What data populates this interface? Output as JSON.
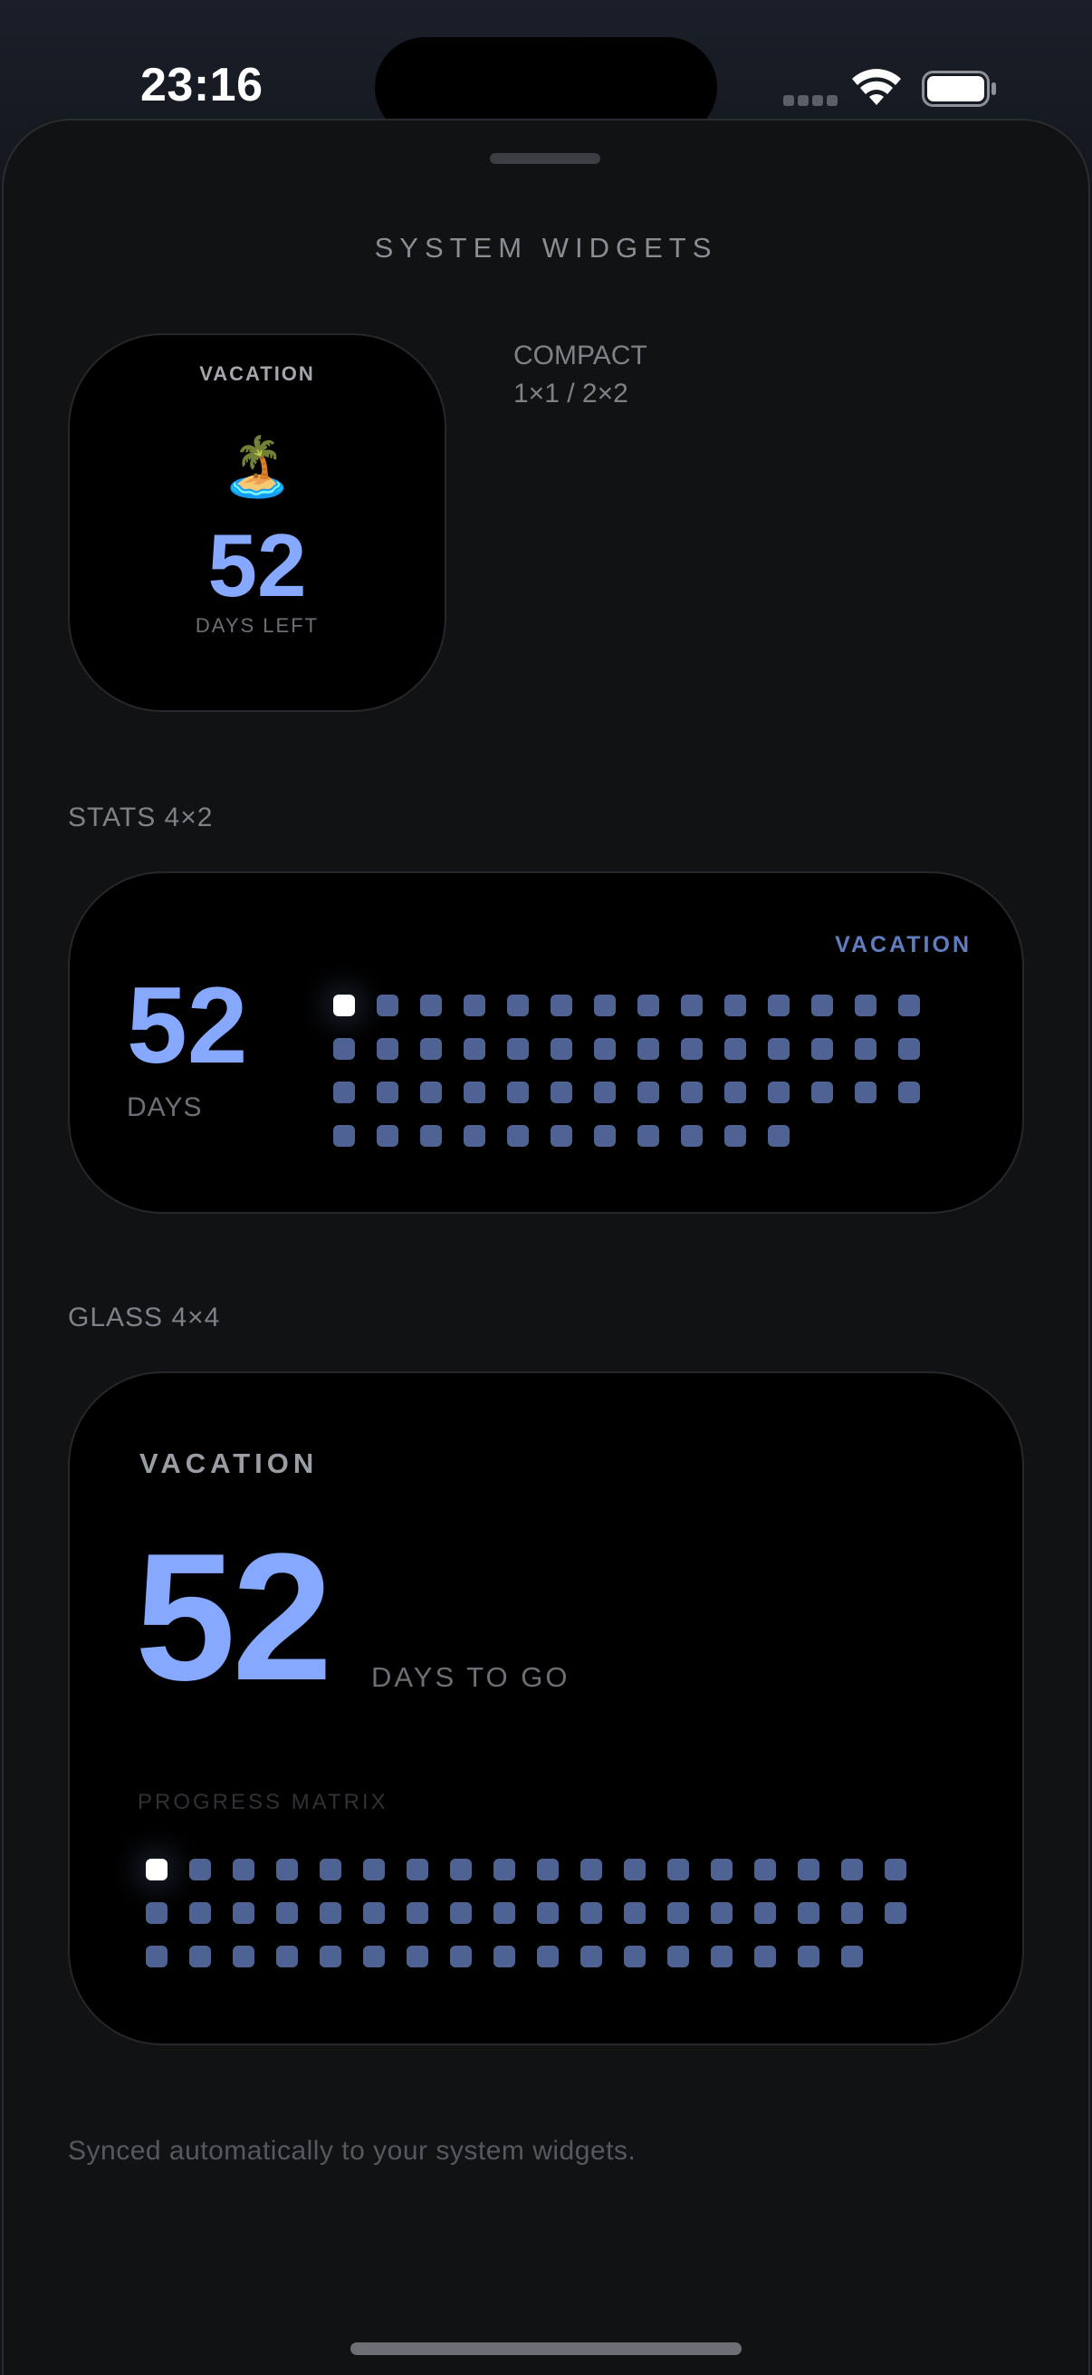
{
  "status_bar": {
    "time": "23:16",
    "icons": [
      "cellular-signal-icon",
      "wifi-icon",
      "battery-icon"
    ]
  },
  "sheet": {
    "title": "SYSTEM WIDGETS"
  },
  "compact_widget": {
    "label": "VACATION",
    "emoji": "🏝️",
    "number": "52",
    "subtitle": "DAYS LEFT",
    "note_line1": "COMPACT",
    "note_line2": "1×1 / 2×2"
  },
  "stats_section": {
    "label": "STATS 4×2",
    "number": "52",
    "subtitle": "DAYS",
    "tag": "VACATION",
    "matrix": {
      "total": 53,
      "columns": 14,
      "current_index": 0
    }
  },
  "glass_section": {
    "label": "GLASS 4×4",
    "widget_label": "VACATION",
    "number": "52",
    "subtitle": "DAYS TO GO",
    "matrix_label": "PROGRESS MATRIX",
    "matrix": {
      "total": 53,
      "columns": 18,
      "current_index": 0
    }
  },
  "footer": {
    "text": "Synced automatically to your system widgets."
  },
  "colors": {
    "accent": "#86a9ff",
    "dot": "#4e6393",
    "dot_current": "#ffffff",
    "background": "#111214"
  }
}
